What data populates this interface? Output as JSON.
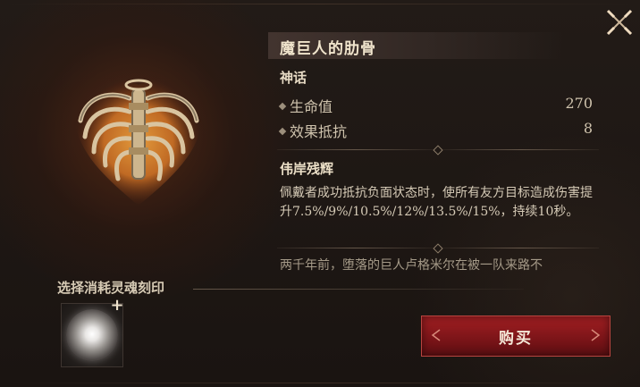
{
  "item": {
    "name": "魔巨人的肋骨",
    "rarity": "神话",
    "stats": [
      {
        "label": "生命值",
        "value": "270"
      },
      {
        "label": "效果抵抗",
        "value": "8"
      }
    ],
    "skill_name": "伟岸残辉",
    "skill_desc": "佩戴者成功抵抗负面状态时，使所有友方目标造成伤害提升7.5%/9%/10.5%/12%/13.5%/15%，持续10秒。",
    "lore": "两千年前，堕落的巨人卢格米尔在被一队来路不"
  },
  "soul_section": {
    "label": "选择消耗灵魂刻印"
  },
  "buttons": {
    "buy": "购买"
  },
  "icons": {
    "close": "close-x-icon",
    "item": "ribcage-relic-icon",
    "soul_slot": "soul-orb-icon",
    "add": "plus-icon"
  },
  "colors": {
    "accent_red": "#8a191c",
    "text_gold": "#f0e4cc"
  }
}
